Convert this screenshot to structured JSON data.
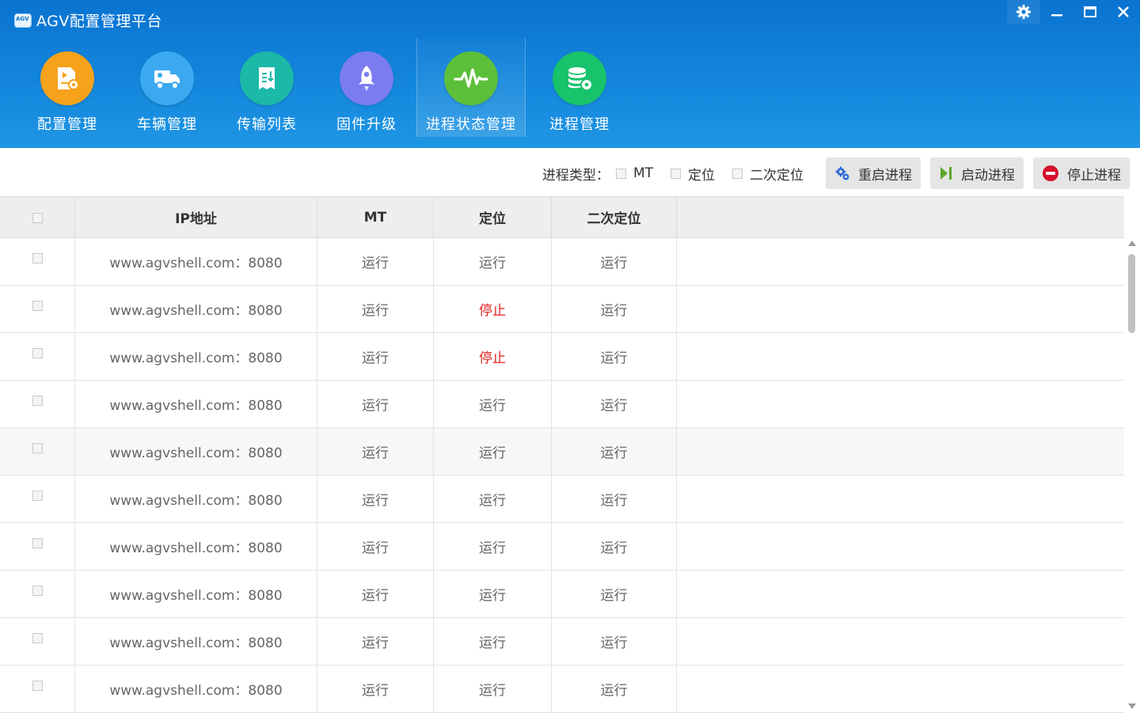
{
  "app": {
    "title": "AGV配置管理平台"
  },
  "colors": {
    "header": "#0a73d0",
    "stop_text": "#e32121",
    "run_text": "#666666"
  },
  "nav": [
    {
      "label": "配置管理",
      "icon": "config-doc-icon",
      "color": "#f7a21b"
    },
    {
      "label": "车辆管理",
      "icon": "truck-icon",
      "color": "#3aa9f0"
    },
    {
      "label": "传输列表",
      "icon": "transfer-list-icon",
      "color": "#1cb8a8"
    },
    {
      "label": "固件升级",
      "icon": "rocket-icon",
      "color": "#7b7cf0"
    },
    {
      "label": "进程状态管理",
      "icon": "pulse-icon",
      "color": "#5cbf3a",
      "active": true
    },
    {
      "label": "进程管理",
      "icon": "database-gear-icon",
      "color": "#18c36b"
    }
  ],
  "toolbar": {
    "type_label": "进程类型：",
    "filters": [
      "MT",
      "定位",
      "二次定位"
    ],
    "buttons": {
      "restart": "重启进程",
      "start": "启动进程",
      "stop": "停止进程"
    }
  },
  "table": {
    "headers": [
      "IP地址",
      "MT",
      "定位",
      "二次定位"
    ],
    "rows": [
      {
        "ip": "www.agvshell.com：8080",
        "mt": "运行",
        "loc": "运行",
        "loc2": "运行"
      },
      {
        "ip": "www.agvshell.com：8080",
        "mt": "运行",
        "loc": "停止",
        "loc2": "运行"
      },
      {
        "ip": "www.agvshell.com：8080",
        "mt": "运行",
        "loc": "停止",
        "loc2": "运行"
      },
      {
        "ip": "www.agvshell.com：8080",
        "mt": "运行",
        "loc": "运行",
        "loc2": "运行"
      },
      {
        "ip": "www.agvshell.com：8080",
        "mt": "运行",
        "loc": "运行",
        "loc2": "运行"
      },
      {
        "ip": "www.agvshell.com：8080",
        "mt": "运行",
        "loc": "运行",
        "loc2": "运行"
      },
      {
        "ip": "www.agvshell.com：8080",
        "mt": "运行",
        "loc": "运行",
        "loc2": "运行"
      },
      {
        "ip": "www.agvshell.com：8080",
        "mt": "运行",
        "loc": "运行",
        "loc2": "运行"
      },
      {
        "ip": "www.agvshell.com：8080",
        "mt": "运行",
        "loc": "运行",
        "loc2": "运行"
      },
      {
        "ip": "www.agvshell.com：8080",
        "mt": "运行",
        "loc": "运行",
        "loc2": "运行"
      }
    ]
  }
}
